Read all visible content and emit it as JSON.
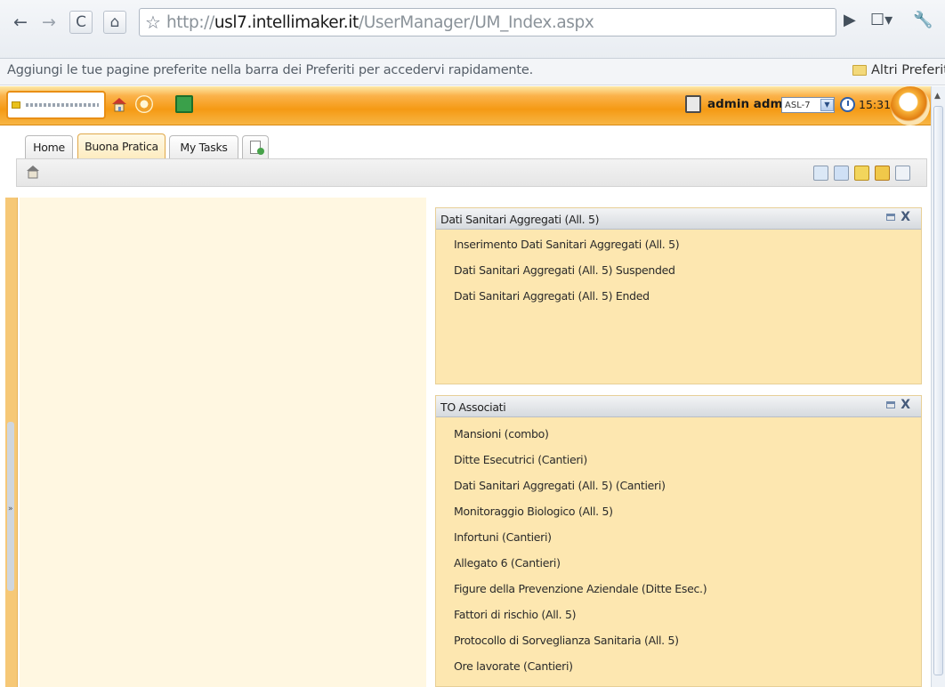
{
  "browser": {
    "url_protocol": "http://",
    "url_host": "usl7.intellimaker.it",
    "url_path": "/UserManager/UM_Index.aspx",
    "bookmarks_message": "Aggiungi le tue pagine preferite nella barra dei Preferiti per accedervi rapidamente.",
    "other_bookmarks": "Altri Preferiti"
  },
  "header": {
    "user": "admin admin",
    "asl_value": "ASL-7",
    "time": "15:31"
  },
  "tabs": [
    {
      "label": "Home"
    },
    {
      "label": "Buona Pratica"
    },
    {
      "label": "My Tasks"
    }
  ],
  "portlets": [
    {
      "title": "Dati Sanitari Aggregati (All. 5)",
      "items": [
        "Inserimento Dati Sanitari Aggregati (All. 5)",
        "Dati Sanitari Aggregati (All. 5) Suspended",
        "Dati Sanitari Aggregati (All. 5) Ended"
      ]
    },
    {
      "title": "TO Associati",
      "items": [
        "Mansioni (combo)",
        "Ditte Esecutrici (Cantieri)",
        "Dati Sanitari Aggregati (All. 5) (Cantieri)",
        "Monitoraggio Biologico (All. 5)",
        "Infortuni (Cantieri)",
        "Allegato 6 (Cantieri)",
        "Figure della Prevenzione Aziendale (Ditte Esec.)",
        "Fattori di rischio (All. 5)",
        "Protocollo di Sorveglianza Sanitaria (All. 5)",
        "Ore lavorate (Cantieri)"
      ]
    }
  ],
  "colors": {
    "accent_orange": "#f59a14",
    "portlet_bg": "#fde7b0",
    "left_panel_bg": "#fff7e1"
  }
}
